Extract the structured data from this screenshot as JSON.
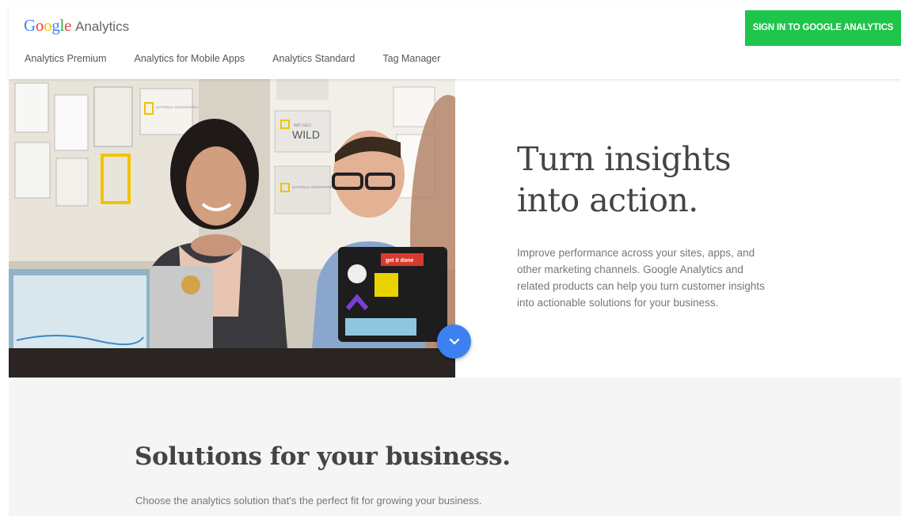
{
  "header": {
    "logo_brand": "Google",
    "logo_product": "Analytics",
    "nav": [
      {
        "label": "Analytics Premium"
      },
      {
        "label": "Analytics for Mobile Apps"
      },
      {
        "label": "Analytics Standard"
      },
      {
        "label": "Tag Manager"
      }
    ],
    "signin_label": "SIGN IN TO GOOGLE ANALYTICS"
  },
  "hero": {
    "title_line1": "Turn insights",
    "title_line2": "into action.",
    "description": "Improve performance across your sites, apps, and other marketing channels. Google Analytics and related products can help you turn customer insights into actionable solutions for your business.",
    "photo_signs": {
      "wild_top": "NAT GEO",
      "wild": "WILD",
      "natgeo": "NATIONAL GEOGRAPHIC",
      "channel": "NATIONAL GEOGRAPHIC CHANNEL",
      "sticker": "get it done"
    },
    "scroll_icon": "chevron-down-icon"
  },
  "solutions": {
    "title": "Solutions for your business.",
    "description": "Choose the analytics solution that's the perfect fit for growing your business."
  },
  "colors": {
    "signin_green": "#1ec54a",
    "scroll_blue": "#3b82f0",
    "logo_blue": "#4285f4",
    "logo_red": "#ea4335",
    "logo_yellow": "#fbbc05",
    "logo_green": "#34a853",
    "section_gray": "#f5f5f5"
  }
}
